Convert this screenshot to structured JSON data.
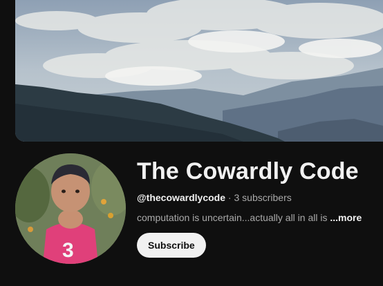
{
  "channel": {
    "name": "The Cowardly Code",
    "handle": "@thecowardlycode",
    "separator": "·",
    "subscribers": "3 subscribers",
    "description": "computation is uncertain...actually all in all is",
    "more_label": "...more",
    "subscribe_label": "Subscribe"
  },
  "colors": {
    "background": "#0f0f0f",
    "text_primary": "#f1f1f1",
    "text_secondary": "#aaaaaa",
    "button_bg": "#f1f1f1",
    "button_text": "#0f0f0f"
  },
  "images": {
    "banner": "mountain-landscape-banner",
    "avatar": "child-avatar"
  }
}
